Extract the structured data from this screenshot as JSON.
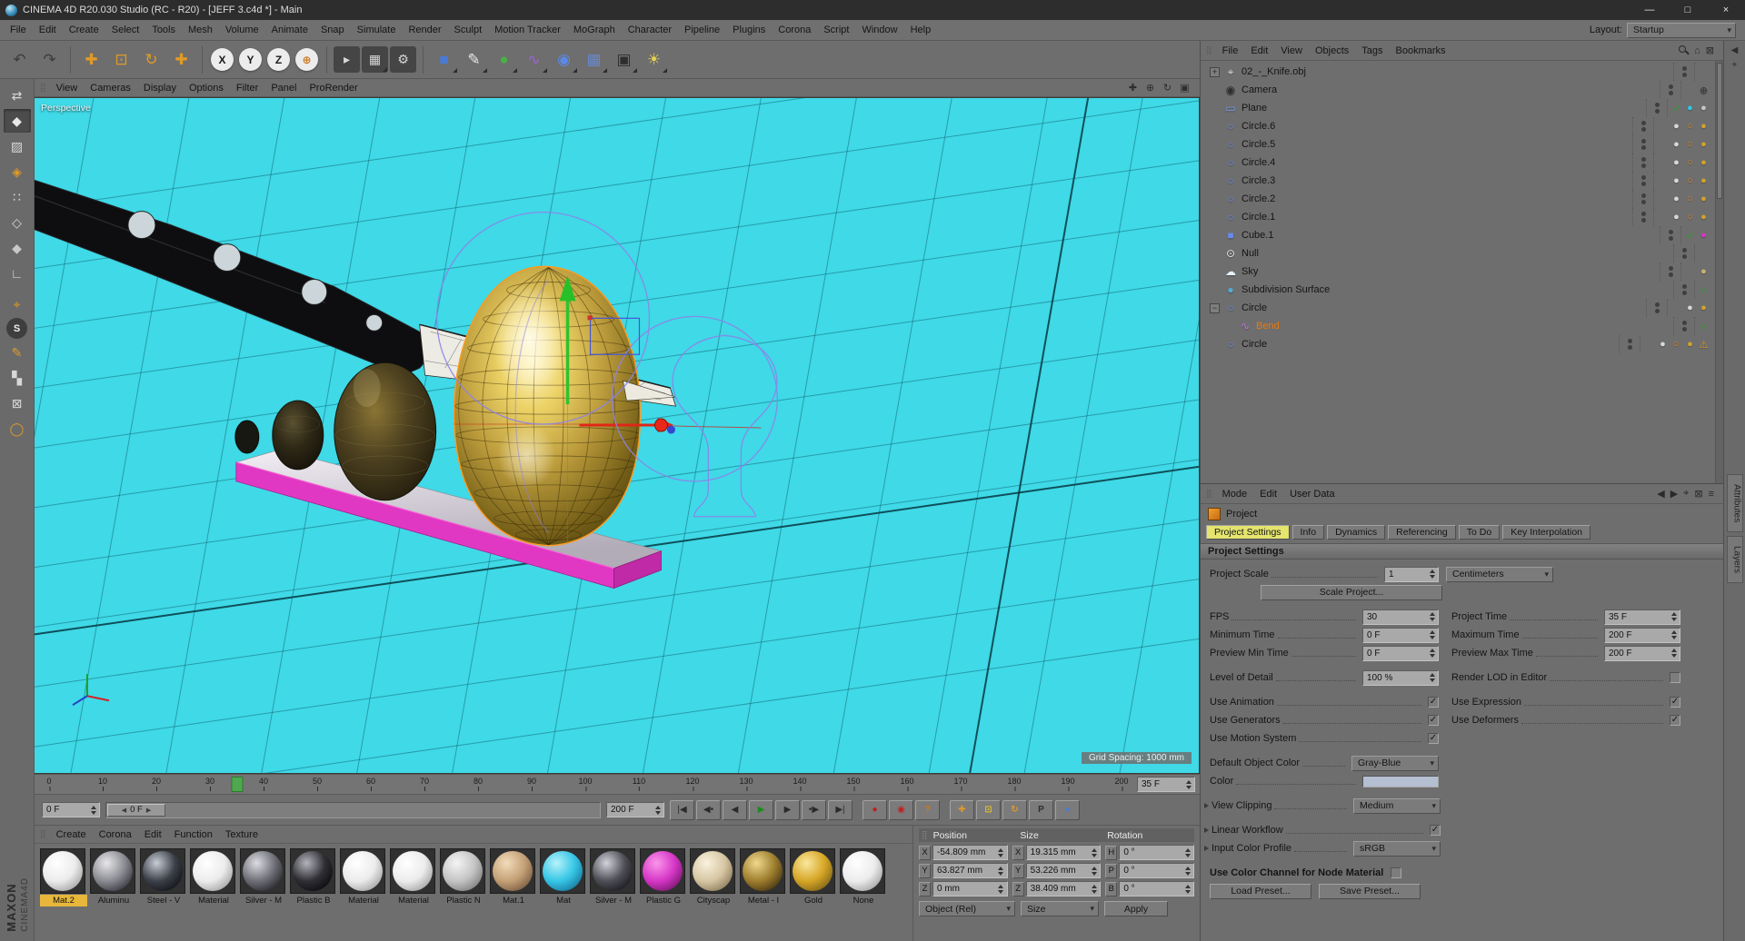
{
  "window": {
    "title": "CINEMA 4D R20.030 Studio (RC - R20) - [JEFF 3.c4d *] - Main",
    "minimize": "—",
    "maximize": "□",
    "close": "×"
  },
  "menubar": {
    "items": [
      "File",
      "Edit",
      "Create",
      "Select",
      "Tools",
      "Mesh",
      "Volume",
      "Animate",
      "Snap",
      "Simulate",
      "Render",
      "Sculpt",
      "Motion Tracker",
      "MoGraph",
      "Character",
      "Pipeline",
      "Plugins",
      "Corona",
      "Script",
      "Window",
      "Help"
    ],
    "layout_label": "Layout:",
    "layout_value": "Startup"
  },
  "toolbar": [
    {
      "name": "undo-button",
      "glyph": "↶",
      "fg": "#3c3c3c"
    },
    {
      "name": "redo-button",
      "glyph": "↷",
      "fg": "#3c3c3c"
    },
    {
      "name": "sep"
    },
    {
      "name": "move-tool",
      "glyph": "✚",
      "fg": "#e09a28"
    },
    {
      "name": "scale-tool",
      "glyph": "⊡",
      "fg": "#e09a28"
    },
    {
      "name": "rotate-tool",
      "glyph": "↻",
      "fg": "#e09a28"
    },
    {
      "name": "active-tool",
      "glyph": "✚",
      "fg": "#e09a28"
    },
    {
      "name": "sep"
    },
    {
      "name": "lock-x-axis",
      "glyph": "X",
      "fg": "#1a1a1a",
      "circle": true
    },
    {
      "name": "lock-y-axis",
      "glyph": "Y",
      "fg": "#1a1a1a",
      "circle": true
    },
    {
      "name": "lock-z-axis",
      "glyph": "Z",
      "fg": "#1a1a1a",
      "circle": true
    },
    {
      "name": "coordinate-system",
      "glyph": "⊕",
      "fg": "#c87820",
      "circle": true
    },
    {
      "name": "sep"
    },
    {
      "name": "render-view",
      "glyph": "▸",
      "fg": "#d8d8d8",
      "dark": true
    },
    {
      "name": "render-picture-viewer",
      "glyph": "▦",
      "fg": "#d8d8d8",
      "dark": true,
      "corner": true
    },
    {
      "name": "edit-render-settings",
      "glyph": "⚙",
      "fg": "#d8d8d8",
      "dark": true
    },
    {
      "name": "sep"
    },
    {
      "name": "cube-primitive",
      "glyph": "■",
      "fg": "#4a7ad8",
      "corner": true
    },
    {
      "name": "spline-pen",
      "glyph": "✎",
      "fg": "#e8e8e8",
      "corner": true
    },
    {
      "name": "subdivision-surface-generator",
      "glyph": "●",
      "fg": "#48b048",
      "corner": true
    },
    {
      "name": "bend-deformer",
      "glyph": "∿",
      "fg": "#9a62d8",
      "corner": true
    },
    {
      "name": "volume-builder",
      "glyph": "◉",
      "fg": "#5a8ae8",
      "corner": true
    },
    {
      "name": "mograph-cloner",
      "glyph": "▦",
      "fg": "#6a88c8",
      "corner": true
    },
    {
      "name": "camera-tool",
      "glyph": "▣",
      "fg": "#2e2e2e",
      "corner": true
    },
    {
      "name": "light-tool",
      "glyph": "☀",
      "fg": "#e8d050",
      "corner": true
    }
  ],
  "left_toolbar": [
    {
      "name": "convert-tool",
      "glyph": "⇄",
      "fg": "#d8d8d8"
    },
    {
      "name": "model-mode",
      "glyph": "◆",
      "fg": "#e8e8e8",
      "active": true
    },
    {
      "name": "texture-mode",
      "glyph": "▨",
      "fg": "#d8d8d8"
    },
    {
      "name": "workplane-mode",
      "glyph": "◈",
      "fg": "#e09a28"
    },
    {
      "name": "points-mode",
      "glyph": "∷",
      "fg": "#d8d8d8"
    },
    {
      "name": "edges-mode",
      "glyph": "◇",
      "fg": "#d8d8d8"
    },
    {
      "name": "polygons-mode",
      "glyph": "◆",
      "fg": "#c8c8c8"
    },
    {
      "name": "workplane-tool",
      "glyph": "∟",
      "fg": "#d8d8d8"
    },
    {
      "name": "sep"
    },
    {
      "name": "axis-mode",
      "glyph": "⌖",
      "fg": "#e09a28"
    },
    {
      "name": "snap-settings",
      "glyph": "S",
      "fg": "#f0f0f0",
      "dark": true
    },
    {
      "name": "paint-tool",
      "glyph": "✎",
      "fg": "#e09a28"
    },
    {
      "name": "quantize-toggle",
      "glyph": "▚",
      "fg": "#d8d8d8"
    },
    {
      "name": "lock-workplane",
      "glyph": "⊠",
      "fg": "#d8d8d8"
    },
    {
      "name": "magnet-tool",
      "glyph": "◯",
      "fg": "#e09a28"
    }
  ],
  "brand": {
    "name": "MAXON",
    "product": "CINEMA4D"
  },
  "viewport": {
    "menus": [
      "View",
      "Cameras",
      "Display",
      "Options",
      "Filter",
      "Panel",
      "ProRender"
    ],
    "corner_icons": [
      {
        "name": "pan-view-icon",
        "glyph": "✚"
      },
      {
        "name": "zoom-view-icon",
        "glyph": "⊕"
      },
      {
        "name": "rotate-view-icon",
        "glyph": "↻"
      },
      {
        "name": "toggle-view-icon",
        "glyph": "▣"
      }
    ],
    "view_label": "Perspective",
    "grid_chip": "Grid Spacing: 1000 mm"
  },
  "timeline": {
    "ticks": [
      "0",
      "10",
      "20",
      "30",
      "40",
      "50",
      "60",
      "70",
      "80",
      "90",
      "100",
      "110",
      "120",
      "130",
      "140",
      "150",
      "160",
      "170",
      "180",
      "190",
      "200"
    ],
    "playhead_frame": 35,
    "range_end_frame": 200,
    "current_frame_field": "35 F",
    "start_field": "0 F",
    "slider_handle": "0 F",
    "end_field": "200 F"
  },
  "transport": [
    {
      "name": "goto-start-button",
      "glyph": "|◀"
    },
    {
      "name": "prev-key-button",
      "glyph": "◀•"
    },
    {
      "name": "prev-frame-button",
      "glyph": "◀"
    },
    {
      "name": "play-button",
      "glyph": "▶",
      "fg": "#1e8a1e"
    },
    {
      "name": "next-frame-button",
      "glyph": "▶"
    },
    {
      "name": "next-key-button",
      "glyph": "•▶"
    },
    {
      "name": "goto-end-button",
      "glyph": "▶|"
    },
    {
      "name": "sep"
    },
    {
      "name": "record-keyframe-button",
      "glyph": "●",
      "fg": "#c02020"
    },
    {
      "name": "autokey-button",
      "glyph": "◉",
      "fg": "#c02020"
    },
    {
      "name": "keyframe-help-button",
      "glyph": "?",
      "fg": "#d07818"
    },
    {
      "name": "sep"
    },
    {
      "name": "key-position-button",
      "glyph": "✚",
      "fg": "#e09a28"
    },
    {
      "name": "key-scale-button",
      "glyph": "⊡",
      "fg": "#e0c028"
    },
    {
      "name": "key-rotation-button",
      "glyph": "↻",
      "fg": "#e09a28"
    },
    {
      "name": "key-parameter-button",
      "glyph": "P",
      "fg": "#2e2e2e"
    },
    {
      "name": "key-pla-button",
      "glyph": "♦",
      "fg": "#4a7ad8"
    }
  ],
  "materials": {
    "menus": [
      "Create",
      "Corona",
      "Edit",
      "Function",
      "Texture"
    ],
    "items": [
      {
        "label": "Mat.2",
        "selected": true,
        "hi": "#ffffff",
        "mid": "#ececec",
        "lo": "#9a9a9a"
      },
      {
        "label": "Aluminu",
        "hi": "#e8e8ea",
        "mid": "#8a8a92",
        "lo": "#2c2c32"
      },
      {
        "label": "Steel - V",
        "hi": "#c8ccd4",
        "mid": "#3c4048",
        "lo": "#0c0e12"
      },
      {
        "label": "Material",
        "hi": "#ffffff",
        "mid": "#ececec",
        "lo": "#9a9a9a"
      },
      {
        "label": "Silver - M",
        "hi": "#dcdce2",
        "mid": "#6e6e76",
        "lo": "#1e1e24"
      },
      {
        "label": "Plastic B",
        "hi": "#b4b4bc",
        "mid": "#2e2e34",
        "lo": "#08080a"
      },
      {
        "label": "Material",
        "hi": "#ffffff",
        "mid": "#ececec",
        "lo": "#9a9a9a"
      },
      {
        "label": "Material",
        "hi": "#ffffff",
        "mid": "#ececec",
        "lo": "#9a9a9a"
      },
      {
        "label": "Plastic N",
        "hi": "#f4f4f4",
        "mid": "#c4c4c4",
        "lo": "#747474"
      },
      {
        "label": "Mat.1",
        "hi": "#f2dcba",
        "mid": "#c4a076",
        "lo": "#6e523a"
      },
      {
        "label": "Mat",
        "hi": "#b6f2fa",
        "mid": "#36c6e6",
        "lo": "#146e96"
      },
      {
        "label": "Silver - M",
        "hi": "#d2d2da",
        "mid": "#4e4e56",
        "lo": "#141418"
      },
      {
        "label": "Plastic G",
        "hi": "#fa96ea",
        "mid": "#d636c6",
        "lo": "#6a1462"
      },
      {
        "label": "Cityscap",
        "hi": "#faf2de",
        "mid": "#d6c6a2",
        "lo": "#827252"
      },
      {
        "label": "Metal - I",
        "hi": "#f0d88e",
        "mid": "#9e7e2e",
        "lo": "#3c2c0e"
      },
      {
        "label": "Gold",
        "hi": "#fae89e",
        "mid": "#d6a626",
        "lo": "#745c16"
      },
      {
        "label": "None",
        "hi": "#ffffff",
        "mid": "#ececec",
        "lo": "#9a9a9a"
      }
    ]
  },
  "coordinates": {
    "headers": [
      "Position",
      "Size",
      "Rotation"
    ],
    "rows": [
      {
        "cells": [
          {
            "n": "position-x-field",
            "axis": "X",
            "value": "-54.809 mm"
          },
          {
            "n": "size-x-field",
            "axis": "X",
            "value": "19.315 mm"
          },
          {
            "n": "rotation-h-field",
            "axis": "H",
            "value": "0 °"
          }
        ]
      },
      {
        "cells": [
          {
            "n": "position-y-field",
            "axis": "Y",
            "value": "63.827 mm"
          },
          {
            "n": "size-y-field",
            "axis": "Y",
            "value": "53.226 mm"
          },
          {
            "n": "rotation-p-field",
            "axis": "P",
            "value": "0 °"
          }
        ]
      },
      {
        "cells": [
          {
            "n": "position-z-field",
            "axis": "Z",
            "value": "0 mm"
          },
          {
            "n": "size-z-field",
            "axis": "Z",
            "value": "38.409 mm"
          },
          {
            "n": "rotation-b-field",
            "axis": "B",
            "value": "0 °"
          }
        ]
      }
    ],
    "mode_object": "Object (Rel)",
    "mode_size": "Size",
    "apply_label": "Apply"
  },
  "object_manager": {
    "menus": [
      "File",
      "Edit",
      "View",
      "Objects",
      "Tags",
      "Bookmarks"
    ],
    "header_icons": [
      {
        "name": "search-icon",
        "css": "search"
      },
      {
        "name": "home-icon",
        "glyph": "⌂"
      },
      {
        "name": "lock-icon",
        "glyph": "⊠"
      }
    ],
    "objects": [
      {
        "name": "02_-_Knife.obj",
        "expander": "+",
        "icon": "⌖",
        "ic": "#e2e2e2",
        "tags": []
      },
      {
        "name": "Camera",
        "icon": "◉",
        "ic": "#2f2f2f",
        "tags": [
          {
            "n": "target-tag-icon",
            "g": "⊕",
            "c": "#3a3a3a"
          }
        ]
      },
      {
        "name": "Plane",
        "icon": "▭",
        "ic": "#7a9ae8",
        "check": true,
        "tags": [
          {
            "n": "texture-tag-icon",
            "g": "●",
            "c": "#2cc8e8"
          },
          {
            "n": "material-tag-icon",
            "g": "●",
            "c": "#c6c6c6"
          }
        ]
      },
      {
        "name": "Circle.6",
        "icon": "○",
        "ic": "#6a8ae8",
        "tags": [
          {
            "n": "material-tag-icon",
            "g": "●",
            "c": "#d8d8d8"
          },
          {
            "n": "phong-tag-icon",
            "g": "○",
            "c": "#e0881c"
          },
          {
            "n": "material-tag-icon",
            "g": "●",
            "c": "#d2a22a"
          }
        ]
      },
      {
        "name": "Circle.5",
        "icon": "○",
        "ic": "#6a8ae8",
        "tags": [
          {
            "n": "material-tag-icon",
            "g": "●",
            "c": "#d8d8d8"
          },
          {
            "n": "phong-tag-icon",
            "g": "○",
            "c": "#e0881c"
          },
          {
            "n": "material-tag-icon",
            "g": "●",
            "c": "#d2a22a"
          }
        ]
      },
      {
        "name": "Circle.4",
        "icon": "○",
        "ic": "#6a8ae8",
        "tags": [
          {
            "n": "material-tag-icon",
            "g": "●",
            "c": "#d8d8d8"
          },
          {
            "n": "phong-tag-icon",
            "g": "○",
            "c": "#e0881c"
          },
          {
            "n": "material-tag-icon",
            "g": "●",
            "c": "#d2a22a"
          }
        ]
      },
      {
        "name": "Circle.3",
        "icon": "○",
        "ic": "#6a8ae8",
        "tags": [
          {
            "n": "material-tag-icon",
            "g": "●",
            "c": "#d8d8d8"
          },
          {
            "n": "phong-tag-icon",
            "g": "○",
            "c": "#e0881c"
          },
          {
            "n": "material-tag-icon",
            "g": "●",
            "c": "#d2a22a"
          }
        ]
      },
      {
        "name": "Circle.2",
        "icon": "○",
        "ic": "#6a8ae8",
        "tags": [
          {
            "n": "material-tag-icon",
            "g": "●",
            "c": "#d8d8d8"
          },
          {
            "n": "phong-tag-icon",
            "g": "○",
            "c": "#e0881c"
          },
          {
            "n": "material-tag-icon",
            "g": "●",
            "c": "#d2a22a"
          }
        ]
      },
      {
        "name": "Circle.1",
        "icon": "○",
        "ic": "#6a8ae8",
        "tags": [
          {
            "n": "material-tag-icon",
            "g": "●",
            "c": "#d8d8d8"
          },
          {
            "n": "phong-tag-icon",
            "g": "○",
            "c": "#e0881c"
          },
          {
            "n": "material-tag-icon",
            "g": "●",
            "c": "#d2a22a"
          }
        ]
      },
      {
        "name": "Cube.1",
        "icon": "■",
        "ic": "#6a8ae8",
        "check": true,
        "tags": [
          {
            "n": "material-tag-icon",
            "g": "●",
            "c": "#d636c6"
          }
        ]
      },
      {
        "name": "Null",
        "icon": "⊙",
        "ic": "#e2e2e2",
        "tags": []
      },
      {
        "name": "Sky",
        "icon": "☁",
        "ic": "#e8f2fa",
        "tags": [
          {
            "n": "material-tag-icon",
            "g": "●",
            "c": "#c9b473"
          }
        ]
      },
      {
        "name": "Subdivision Surface",
        "icon": "●",
        "ic": "#52aad8",
        "check": true,
        "tags": []
      },
      {
        "name": "Circle",
        "expander": "−",
        "icon": "○",
        "ic": "#6a8ae8",
        "tags": [
          {
            "n": "material-tag-icon",
            "g": "●",
            "c": "#d8d8d8"
          },
          {
            "n": "material-tag-icon",
            "g": "●",
            "c": "#d2a22a"
          }
        ]
      },
      {
        "name": "Bend",
        "indent": 1,
        "selected": true,
        "icon": "∿",
        "ic": "#b87ad8",
        "check": true,
        "tags": []
      },
      {
        "name": "Circle",
        "icon": "○",
        "ic": "#6a8ae8",
        "tags": [
          {
            "n": "material-tag-icon",
            "g": "●",
            "c": "#d8d8d8"
          },
          {
            "n": "phong-tag-icon",
            "g": "○",
            "c": "#e0881c"
          },
          {
            "n": "material-tag-icon",
            "g": "●",
            "c": "#d2a22a"
          },
          {
            "n": "warning-tag-icon",
            "g": "⚠",
            "c": "#e89a18"
          }
        ]
      }
    ]
  },
  "attributes": {
    "menus": [
      "Mode",
      "Edit",
      "User Data"
    ],
    "header_icons": [
      {
        "name": "history-back-icon",
        "glyph": "◀"
      },
      {
        "name": "history-forward-icon",
        "glyph": "▶"
      },
      {
        "name": "pin-icon",
        "glyph": "⌖"
      },
      {
        "name": "lock-icon",
        "glyph": "⊠"
      },
      {
        "name": "panel-menu-icon",
        "glyph": "≡"
      }
    ],
    "object_label": "Project",
    "tabs": [
      "Project Settings",
      "Info",
      "Dynamics",
      "Referencing",
      "To Do",
      "Key Interpolation"
    ],
    "active_tab": "Project Settings",
    "section_title": "Project Settings",
    "project_scale_label": "Project Scale",
    "project_scale_value": "1",
    "project_scale_unit": "Centimeters",
    "scale_project_label": "Scale Project...",
    "fps_label": "FPS",
    "fps_value": "30",
    "project_time_label": "Project Time",
    "project_time_value": "35 F",
    "min_time_label": "Minimum Time",
    "min_time_value": "0 F",
    "max_time_label": "Maximum Time",
    "max_time_value": "200 F",
    "preview_min_label": "Preview Min Time",
    "preview_min_value": "0 F",
    "preview_max_label": "Preview Max Time",
    "preview_max_value": "200 F",
    "lod_label": "Level of Detail",
    "lod_value": "100 %",
    "render_lod_label": "Render LOD in Editor",
    "render_lod_checked": false,
    "use_animation_label": "Use Animation",
    "use_animation_checked": true,
    "use_expression_label": "Use Expression",
    "use_expression_checked": true,
    "use_generators_label": "Use Generators",
    "use_generators_checked": true,
    "use_deformers_label": "Use Deformers",
    "use_deformers_checked": true,
    "use_motion_label": "Use Motion System",
    "use_motion_checked": true,
    "default_color_label": "Default Object Color",
    "default_color_value": "Gray-Blue",
    "color_label": "Color",
    "color_swatch": "#b4bfd2",
    "view_clipping_label": "View Clipping",
    "view_clipping_value": "Medium",
    "linear_workflow_label": "Linear Workflow",
    "linear_workflow_checked": true,
    "input_profile_label": "Input Color Profile",
    "input_profile_value": "sRGB",
    "use_color_channel_label": "Use Color Channel for Node Material",
    "use_color_channel_checked": false,
    "load_preset_label": "Load Preset...",
    "save_preset_label": "Save Preset..."
  },
  "side_tabs": [
    "Attributes",
    "Layers"
  ],
  "edge_icons": [
    {
      "name": "collapse-panel-icon",
      "glyph": "◀"
    },
    {
      "name": "pin-panel-icon",
      "glyph": "⌖"
    }
  ]
}
